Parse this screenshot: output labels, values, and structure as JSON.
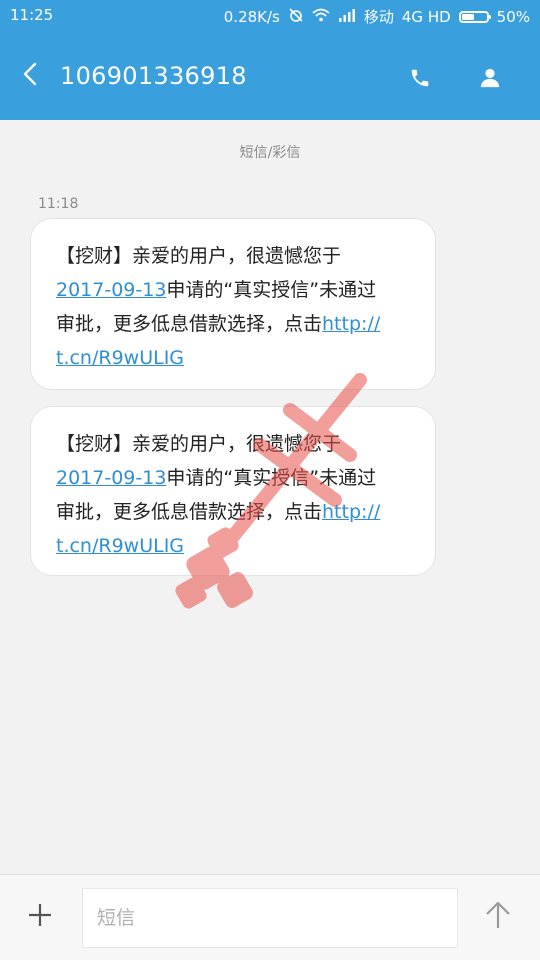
{
  "status_bar": {
    "time": "11:25",
    "speed": "0.28K/s",
    "carrier": "移动",
    "network": "4G HD",
    "battery": "50%",
    "battery_level": 0.5
  },
  "header": {
    "title": "106901336918"
  },
  "thread": {
    "type_label": "短信/彩信",
    "time": "11:18",
    "messages": [
      {
        "lines": [
          "【挖财】亲爱的用户，很遗憾您于"
        ],
        "date_link": "2017-09-13",
        "after_date": "申请的“真实授信”未通过",
        "line3_text": "审批，更多低息借款选择，点击",
        "url_part1": "http://",
        "url_part2": "t.cn/R9wULIG"
      },
      {
        "lines": [
          "【挖财】亲爱的用户，很遗憾您于"
        ],
        "date_link": "2017-09-13",
        "after_date": "申请的“真实授信”未通过",
        "line3_text": "审批，更多低息借款选择，点击",
        "url_part1": "http://",
        "url_part2": "t.cn/R9wULIG"
      }
    ]
  },
  "composer": {
    "placeholder": "短信"
  },
  "colors": {
    "accent": "#3a9fdd",
    "link": "#2e8fd6",
    "watermark": "#e8524a"
  }
}
